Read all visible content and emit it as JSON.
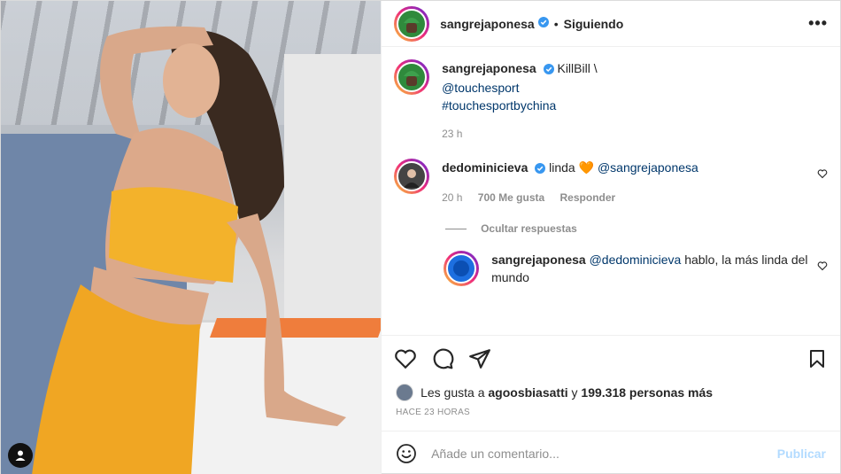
{
  "colors": {
    "accent": "#0095f6",
    "verified": "#3897f0",
    "muted": "#8e8e8e",
    "link": "#00376b",
    "publish_disabled": "#b3dbff"
  },
  "header": {
    "username": "sangrejaponesa",
    "separator": "•",
    "follow_status": "Siguiendo",
    "more": "•••"
  },
  "caption": {
    "username": "sangrejaponesa",
    "text": "KillBill \\",
    "mention": "@touchesport",
    "hashtag": "#touchesportbychina",
    "time": "23 h"
  },
  "comment": {
    "username": "dedominicieva",
    "text": "linda",
    "emoji": "🧡",
    "mention": "@sangrejaponesa",
    "time": "20 h",
    "likes": "700 Me gusta",
    "reply": "Responder"
  },
  "hide_replies": "Ocultar respuestas",
  "reply": {
    "username": "sangrejaponesa",
    "mention": "@dedominicieva",
    "text": "hablo, la más linda del mundo"
  },
  "likes_line": {
    "prefix": "Les gusta a",
    "user": "agoosbiasatti",
    "middle": "y",
    "count": "199.318 personas más"
  },
  "post_time": "HACE 23 HORAS",
  "add_comment": {
    "placeholder": "Añade un comentario...",
    "publish": "Publicar"
  },
  "icons": [
    "heart-icon",
    "comment-icon",
    "share-icon",
    "bookmark-icon",
    "emoji-icon",
    "verified-icon",
    "user-tag-icon"
  ]
}
